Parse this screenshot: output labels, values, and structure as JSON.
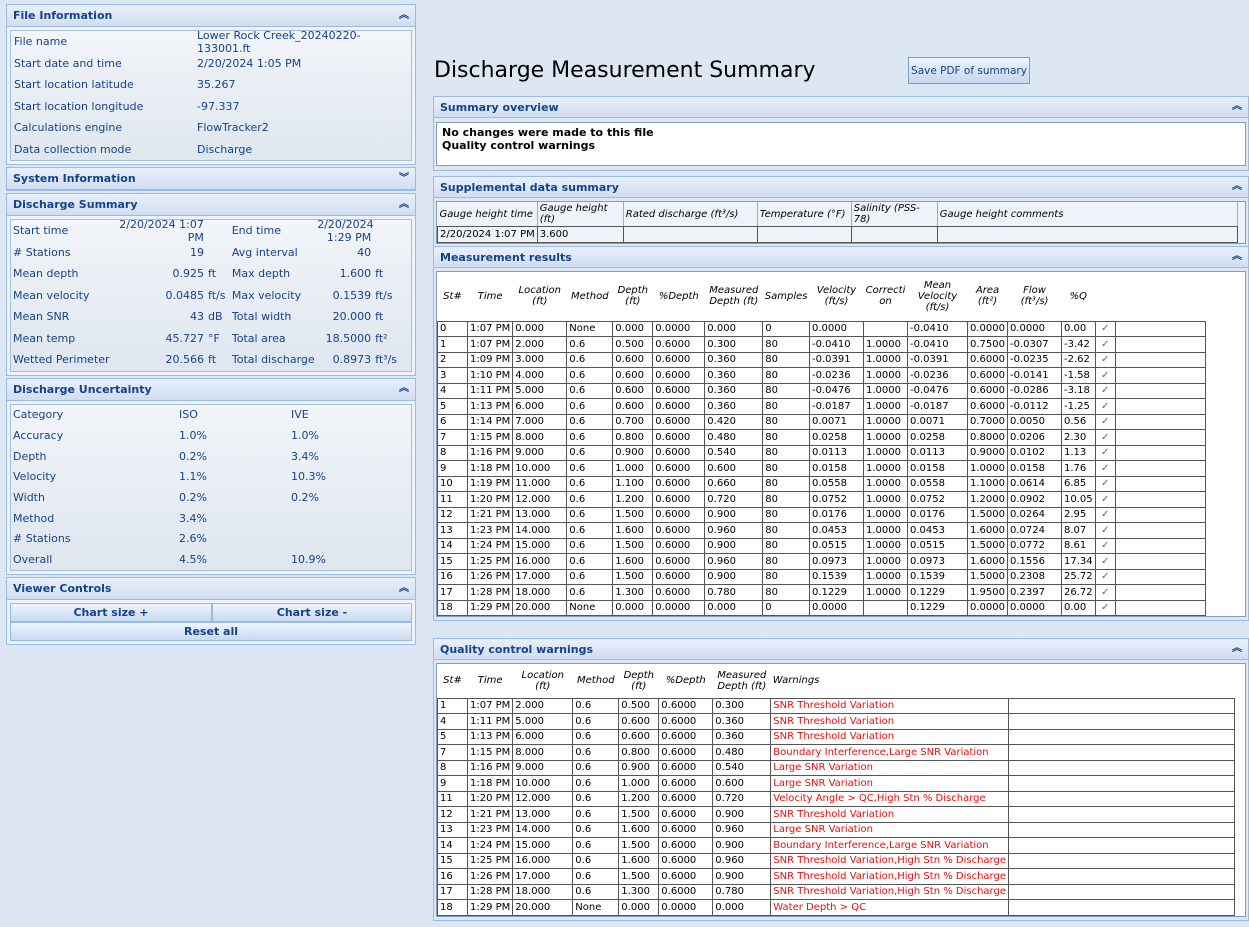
{
  "file_info": {
    "title": "File Information",
    "rows": [
      {
        "label": "File name",
        "value": "Lower Rock Creek_20240220-133001.ft"
      },
      {
        "label": "Start date and time",
        "value": "2/20/2024 1:05 PM"
      },
      {
        "label": "Start location latitude",
        "value": "35.267"
      },
      {
        "label": "Start location longitude",
        "value": "-97.337"
      },
      {
        "label": "Calculations engine",
        "value": "FlowTracker2"
      },
      {
        "label": "Data collection mode",
        "value": "Discharge"
      }
    ]
  },
  "system_info": {
    "title": "System Information"
  },
  "discharge_summary": {
    "title": "Discharge Summary",
    "rows": [
      [
        "Start time",
        "2/20/2024 1:07 PM",
        "",
        "End time",
        "2/20/2024 1:29 PM",
        ""
      ],
      [
        "# Stations",
        "19",
        "",
        "Avg interval",
        "40",
        ""
      ],
      [
        "Mean depth",
        "0.925",
        "ft",
        "Max depth",
        "1.600",
        "ft"
      ],
      [
        "Mean velocity",
        "0.0485",
        "ft/s",
        "Max velocity",
        "0.1539",
        "ft/s"
      ],
      [
        "Mean SNR",
        "43",
        "dB",
        "Total width",
        "20.000",
        "ft"
      ],
      [
        "Mean temp",
        "45.727",
        "°F",
        "Total area",
        "18.5000",
        "ft²"
      ],
      [
        "Wetted Perimeter",
        "20.566",
        "ft",
        "Total discharge",
        "0.8973",
        "ft³/s"
      ]
    ]
  },
  "discharge_uncertainty": {
    "title": "Discharge Uncertainty",
    "rows": [
      [
        "Category",
        "ISO",
        "IVE"
      ],
      [
        "Accuracy",
        "1.0%",
        "1.0%"
      ],
      [
        "Depth",
        "0.2%",
        "3.4%"
      ],
      [
        "Velocity",
        "1.1%",
        "10.3%"
      ],
      [
        "Width",
        "0.2%",
        "0.2%"
      ],
      [
        "Method",
        "3.4%",
        ""
      ],
      [
        "# Stations",
        "2.6%",
        ""
      ],
      [
        "Overall",
        "4.5%",
        "10.9%"
      ]
    ]
  },
  "viewer_controls": {
    "title": "Viewer Controls",
    "chart_plus": "Chart size +",
    "chart_minus": "Chart size -",
    "reset": "Reset all"
  },
  "page_title": "Discharge Measurement Summary",
  "save_pdf": "Save PDF of summary",
  "summary_overview": {
    "title": "Summary overview",
    "line1": "No changes were made to this file",
    "line2": "Quality control warnings"
  },
  "supplemental": {
    "title": "Supplemental data summary",
    "headers": [
      "Gauge height time",
      "Gauge height (ft)",
      "Rated discharge (ft³/s)",
      "Temperature (°F)",
      "Salinity (PSS-78)",
      "Gauge height comments"
    ],
    "row": [
      "2/20/2024 1:07 PM",
      "3.600",
      "",
      "",
      "",
      ""
    ]
  },
  "measurement": {
    "title": "Measurement results",
    "headers": [
      "St#",
      "Time",
      "Location (ft)",
      "Method",
      "Depth (ft)",
      "%Depth",
      "Measured Depth (ft)",
      "Samples",
      "Velocity (ft/s)",
      "Correcti on",
      "Mean Velocity (ft/s)",
      "Area (ft²)",
      "Flow (ft³/s)",
      "%Q"
    ],
    "check": "✓",
    "rows": [
      [
        "0",
        "1:07 PM",
        "0.000",
        "None",
        "0.000",
        "0.0000",
        "0.000",
        "0",
        "0.0000",
        "",
        "-0.0410",
        "0.0000",
        "0.0000",
        "0.00"
      ],
      [
        "1",
        "1:07 PM",
        "2.000",
        "0.6",
        "0.500",
        "0.6000",
        "0.300",
        "80",
        "-0.0410",
        "1.0000",
        "-0.0410",
        "0.7500",
        "-0.0307",
        "-3.42"
      ],
      [
        "2",
        "1:09 PM",
        "3.000",
        "0.6",
        "0.600",
        "0.6000",
        "0.360",
        "80",
        "-0.0391",
        "1.0000",
        "-0.0391",
        "0.6000",
        "-0.0235",
        "-2.62"
      ],
      [
        "3",
        "1:10 PM",
        "4.000",
        "0.6",
        "0.600",
        "0.6000",
        "0.360",
        "80",
        "-0.0236",
        "1.0000",
        "-0.0236",
        "0.6000",
        "-0.0141",
        "-1.58"
      ],
      [
        "4",
        "1:11 PM",
        "5.000",
        "0.6",
        "0.600",
        "0.6000",
        "0.360",
        "80",
        "-0.0476",
        "1.0000",
        "-0.0476",
        "0.6000",
        "-0.0286",
        "-3.18"
      ],
      [
        "5",
        "1:13 PM",
        "6.000",
        "0.6",
        "0.600",
        "0.6000",
        "0.360",
        "80",
        "-0.0187",
        "1.0000",
        "-0.0187",
        "0.6000",
        "-0.0112",
        "-1.25"
      ],
      [
        "6",
        "1:14 PM",
        "7.000",
        "0.6",
        "0.700",
        "0.6000",
        "0.420",
        "80",
        "0.0071",
        "1.0000",
        "0.0071",
        "0.7000",
        "0.0050",
        "0.56"
      ],
      [
        "7",
        "1:15 PM",
        "8.000",
        "0.6",
        "0.800",
        "0.6000",
        "0.480",
        "80",
        "0.0258",
        "1.0000",
        "0.0258",
        "0.8000",
        "0.0206",
        "2.30"
      ],
      [
        "8",
        "1:16 PM",
        "9.000",
        "0.6",
        "0.900",
        "0.6000",
        "0.540",
        "80",
        "0.0113",
        "1.0000",
        "0.0113",
        "0.9000",
        "0.0102",
        "1.13"
      ],
      [
        "9",
        "1:18 PM",
        "10.000",
        "0.6",
        "1.000",
        "0.6000",
        "0.600",
        "80",
        "0.0158",
        "1.0000",
        "0.0158",
        "1.0000",
        "0.0158",
        "1.76"
      ],
      [
        "10",
        "1:19 PM",
        "11.000",
        "0.6",
        "1.100",
        "0.6000",
        "0.660",
        "80",
        "0.0558",
        "1.0000",
        "0.0558",
        "1.1000",
        "0.0614",
        "6.85"
      ],
      [
        "11",
        "1:20 PM",
        "12.000",
        "0.6",
        "1.200",
        "0.6000",
        "0.720",
        "80",
        "0.0752",
        "1.0000",
        "0.0752",
        "1.2000",
        "0.0902",
        "10.05"
      ],
      [
        "12",
        "1:21 PM",
        "13.000",
        "0.6",
        "1.500",
        "0.6000",
        "0.900",
        "80",
        "0.0176",
        "1.0000",
        "0.0176",
        "1.5000",
        "0.0264",
        "2.95"
      ],
      [
        "13",
        "1:23 PM",
        "14.000",
        "0.6",
        "1.600",
        "0.6000",
        "0.960",
        "80",
        "0.0453",
        "1.0000",
        "0.0453",
        "1.6000",
        "0.0724",
        "8.07"
      ],
      [
        "14",
        "1:24 PM",
        "15.000",
        "0.6",
        "1.500",
        "0.6000",
        "0.900",
        "80",
        "0.0515",
        "1.0000",
        "0.0515",
        "1.5000",
        "0.0772",
        "8.61"
      ],
      [
        "15",
        "1:25 PM",
        "16.000",
        "0.6",
        "1.600",
        "0.6000",
        "0.960",
        "80",
        "0.0973",
        "1.0000",
        "0.0973",
        "1.6000",
        "0.1556",
        "17.34"
      ],
      [
        "16",
        "1:26 PM",
        "17.000",
        "0.6",
        "1.500",
        "0.6000",
        "0.900",
        "80",
        "0.1539",
        "1.0000",
        "0.1539",
        "1.5000",
        "0.2308",
        "25.72"
      ],
      [
        "17",
        "1:28 PM",
        "18.000",
        "0.6",
        "1.300",
        "0.6000",
        "0.780",
        "80",
        "0.1229",
        "1.0000",
        "0.1229",
        "1.9500",
        "0.2397",
        "26.72"
      ],
      [
        "18",
        "1:29 PM",
        "20.000",
        "None",
        "0.000",
        "0.0000",
        "0.000",
        "0",
        "0.0000",
        "",
        "0.1229",
        "0.0000",
        "0.0000",
        "0.00"
      ]
    ]
  },
  "qc": {
    "title": "Quality control warnings",
    "headers": [
      "St#",
      "Time",
      "Location (ft)",
      "Method",
      "Depth (ft)",
      "%Depth",
      "Measured Depth (ft)",
      "Warnings"
    ],
    "rows": [
      [
        "1",
        "1:07 PM",
        "2.000",
        "0.6",
        "0.500",
        "0.6000",
        "0.300",
        "SNR Threshold Variation"
      ],
      [
        "4",
        "1:11 PM",
        "5.000",
        "0.6",
        "0.600",
        "0.6000",
        "0.360",
        "SNR Threshold Variation"
      ],
      [
        "5",
        "1:13 PM",
        "6.000",
        "0.6",
        "0.600",
        "0.6000",
        "0.360",
        "SNR Threshold Variation"
      ],
      [
        "7",
        "1:15 PM",
        "8.000",
        "0.6",
        "0.800",
        "0.6000",
        "0.480",
        "Boundary Interference,Large SNR Variation"
      ],
      [
        "8",
        "1:16 PM",
        "9.000",
        "0.6",
        "0.900",
        "0.6000",
        "0.540",
        "Large SNR Variation"
      ],
      [
        "9",
        "1:18 PM",
        "10.000",
        "0.6",
        "1.000",
        "0.6000",
        "0.600",
        "Large SNR Variation"
      ],
      [
        "11",
        "1:20 PM",
        "12.000",
        "0.6",
        "1.200",
        "0.6000",
        "0.720",
        "Velocity Angle > QC,High Stn % Discharge"
      ],
      [
        "12",
        "1:21 PM",
        "13.000",
        "0.6",
        "1.500",
        "0.6000",
        "0.900",
        "SNR Threshold Variation"
      ],
      [
        "13",
        "1:23 PM",
        "14.000",
        "0.6",
        "1.600",
        "0.6000",
        "0.960",
        "Large SNR Variation"
      ],
      [
        "14",
        "1:24 PM",
        "15.000",
        "0.6",
        "1.500",
        "0.6000",
        "0.900",
        "Boundary Interference,Large SNR Variation"
      ],
      [
        "15",
        "1:25 PM",
        "16.000",
        "0.6",
        "1.600",
        "0.6000",
        "0.960",
        "SNR Threshold Variation,High Stn % Discharge"
      ],
      [
        "16",
        "1:26 PM",
        "17.000",
        "0.6",
        "1.500",
        "0.6000",
        "0.900",
        "SNR Threshold Variation,High Stn % Discharge"
      ],
      [
        "17",
        "1:28 PM",
        "18.000",
        "0.6",
        "1.300",
        "0.6000",
        "0.780",
        "SNR Threshold Variation,High Stn % Discharge"
      ],
      [
        "18",
        "1:29 PM",
        "20.000",
        "None",
        "0.000",
        "0.0000",
        "0.000",
        "Water Depth > QC"
      ]
    ]
  },
  "colors": {
    "accent": "#15428b",
    "panel_border": "#99bbe8",
    "warning": "#e01010",
    "check": "#2e8b2e"
  },
  "icons": {
    "collapse": "double-chevron-up-icon",
    "expand": "double-chevron-down-icon"
  }
}
